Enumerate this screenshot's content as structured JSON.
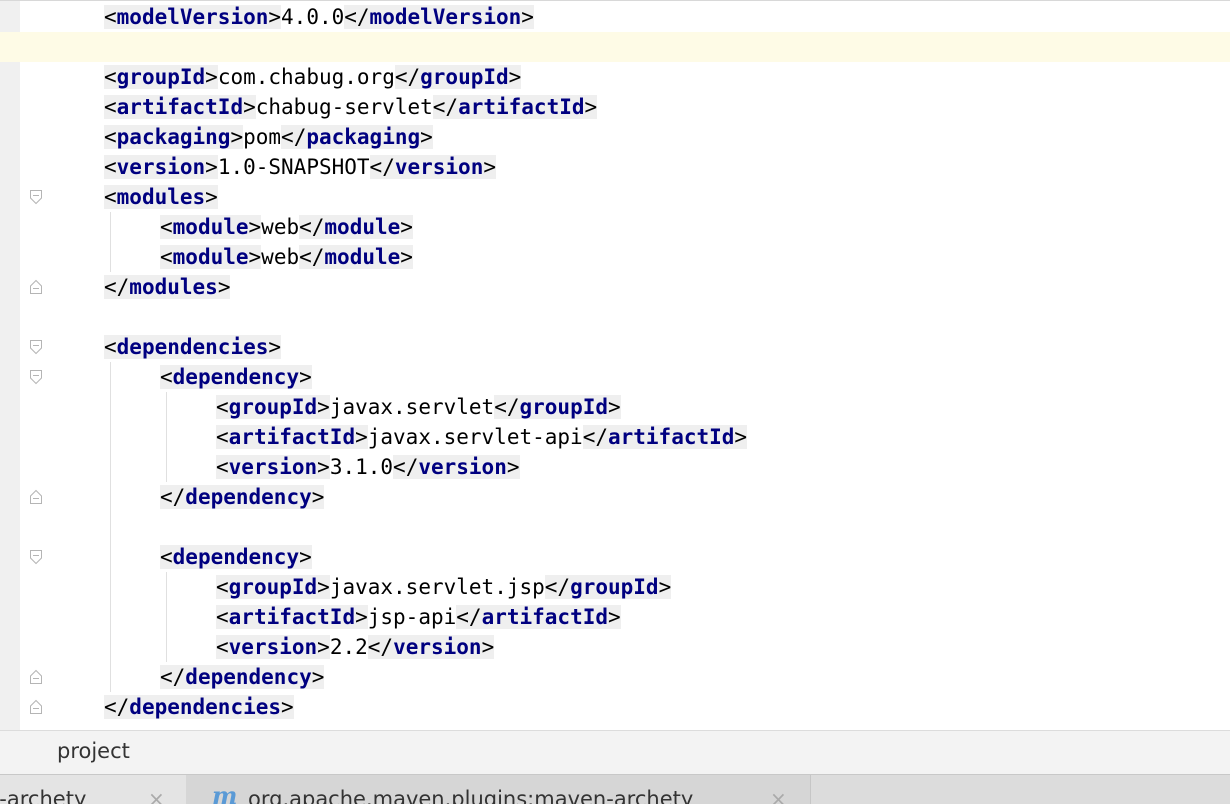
{
  "editor": {
    "lines": [
      {
        "indent": 0,
        "segments": [
          {
            "t": "tag",
            "v": "modelVersion"
          },
          {
            "t": "text",
            "v": "4.0.0"
          },
          {
            "t": "ctag",
            "v": "modelVersion"
          }
        ]
      },
      {
        "indent": 0,
        "segments": [],
        "current": true
      },
      {
        "indent": 0,
        "segments": [
          {
            "t": "tag",
            "v": "groupId"
          },
          {
            "t": "text",
            "v": "com.chabug.org"
          },
          {
            "t": "ctag",
            "v": "groupId"
          }
        ]
      },
      {
        "indent": 0,
        "segments": [
          {
            "t": "tag",
            "v": "artifactId"
          },
          {
            "t": "text",
            "v": "chabug-servlet"
          },
          {
            "t": "ctag",
            "v": "artifactId"
          }
        ]
      },
      {
        "indent": 0,
        "segments": [
          {
            "t": "tag",
            "v": "packaging"
          },
          {
            "t": "text",
            "v": "pom"
          },
          {
            "t": "ctag",
            "v": "packaging"
          }
        ]
      },
      {
        "indent": 0,
        "segments": [
          {
            "t": "tag",
            "v": "version"
          },
          {
            "t": "text",
            "v": "1.0-SNAPSHOT"
          },
          {
            "t": "ctag",
            "v": "version"
          }
        ]
      },
      {
        "indent": 0,
        "segments": [
          {
            "t": "tag",
            "v": "modules"
          }
        ],
        "fold": "open"
      },
      {
        "indent": 1,
        "segments": [
          {
            "t": "tag",
            "v": "module"
          },
          {
            "t": "text",
            "v": "web"
          },
          {
            "t": "ctag",
            "v": "module"
          }
        ]
      },
      {
        "indent": 1,
        "segments": [
          {
            "t": "tag",
            "v": "module"
          },
          {
            "t": "text",
            "v": "web"
          },
          {
            "t": "ctag",
            "v": "module"
          }
        ]
      },
      {
        "indent": 0,
        "segments": [
          {
            "t": "ctag",
            "v": "modules"
          }
        ],
        "fold": "close"
      },
      {
        "indent": 0,
        "segments": []
      },
      {
        "indent": 0,
        "segments": [
          {
            "t": "tag",
            "v": "dependencies"
          }
        ],
        "fold": "open"
      },
      {
        "indent": 1,
        "segments": [
          {
            "t": "tag",
            "v": "dependency"
          }
        ],
        "fold": "open"
      },
      {
        "indent": 2,
        "segments": [
          {
            "t": "tag",
            "v": "groupId"
          },
          {
            "t": "text",
            "v": "javax.servlet"
          },
          {
            "t": "ctag",
            "v": "groupId"
          }
        ]
      },
      {
        "indent": 2,
        "segments": [
          {
            "t": "tag",
            "v": "artifactId"
          },
          {
            "t": "text",
            "v": "javax.servlet-api"
          },
          {
            "t": "ctag",
            "v": "artifactId"
          }
        ]
      },
      {
        "indent": 2,
        "segments": [
          {
            "t": "tag",
            "v": "version"
          },
          {
            "t": "text",
            "v": "3.1.0"
          },
          {
            "t": "ctag",
            "v": "version"
          }
        ]
      },
      {
        "indent": 1,
        "segments": [
          {
            "t": "ctag",
            "v": "dependency"
          }
        ],
        "fold": "close"
      },
      {
        "indent": 0,
        "segments": []
      },
      {
        "indent": 1,
        "segments": [
          {
            "t": "tag",
            "v": "dependency"
          }
        ],
        "fold": "open"
      },
      {
        "indent": 2,
        "segments": [
          {
            "t": "tag",
            "v": "groupId"
          },
          {
            "t": "text",
            "v": "javax.servlet.jsp"
          },
          {
            "t": "ctag",
            "v": "groupId"
          }
        ]
      },
      {
        "indent": 2,
        "segments": [
          {
            "t": "tag",
            "v": "artifactId"
          },
          {
            "t": "text",
            "v": "jsp-api"
          },
          {
            "t": "ctag",
            "v": "artifactId"
          }
        ]
      },
      {
        "indent": 2,
        "segments": [
          {
            "t": "tag",
            "v": "version"
          },
          {
            "t": "text",
            "v": "2.2"
          },
          {
            "t": "ctag",
            "v": "version"
          }
        ]
      },
      {
        "indent": 1,
        "segments": [
          {
            "t": "ctag",
            "v": "dependency"
          }
        ],
        "fold": "close"
      },
      {
        "indent": 0,
        "segments": [
          {
            "t": "ctag",
            "v": "dependencies"
          }
        ],
        "fold": "close"
      }
    ]
  },
  "breadcrumb": {
    "text": "project"
  },
  "tabs": [
    {
      "label": "n-archety",
      "icon": "",
      "close": "×"
    },
    {
      "label": "org.apache.maven.plugins:maven-archety",
      "icon": "maven-m-icon",
      "close": "×"
    }
  ],
  "colors": {
    "tag_name": "#000080",
    "tag_bg": "#efefef",
    "current_line": "#fefbe6"
  }
}
